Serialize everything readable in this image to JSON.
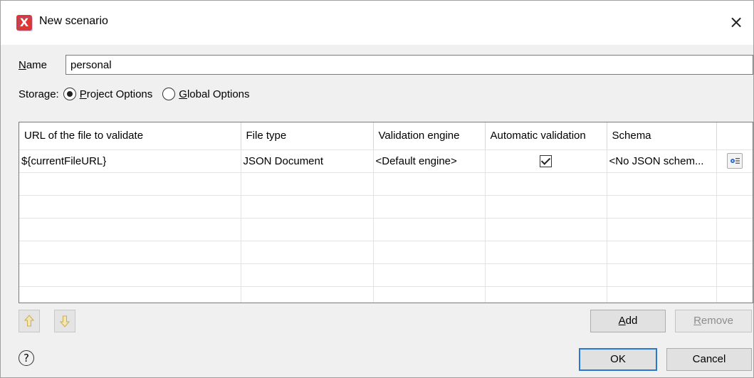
{
  "window": {
    "title": "New scenario",
    "close_glyph": "×"
  },
  "name_field": {
    "label_mnemonic": "N",
    "label_rest": "ame",
    "value": "personal"
  },
  "storage": {
    "label": "Storage:",
    "options": [
      {
        "mnemonic": "P",
        "rest": "roject Options",
        "checked": true
      },
      {
        "mnemonic": "G",
        "rest": "lobal Options",
        "checked": false
      }
    ]
  },
  "table": {
    "columns": [
      "URL of the file to validate",
      "File type",
      "Validation engine",
      "Automatic validation",
      "Schema",
      ""
    ],
    "rows": [
      {
        "url": "${currentFileURL}",
        "file_type": "JSON Document",
        "engine": "<Default engine>",
        "automatic": true,
        "schema": "<No JSON schem..."
      }
    ],
    "empty_rows": 6
  },
  "buttons": {
    "move_up_icon": "arrow-up-icon",
    "move_down_icon": "arrow-down-icon",
    "add_mnemonic": "A",
    "add_rest": "dd",
    "remove_mnemonic": "R",
    "remove_rest": "emove",
    "ok": "OK",
    "cancel": "Cancel",
    "help_glyph": "?"
  },
  "colors": {
    "dialog_bg": "#f0f0f0",
    "default_button_border": "#2a76d2",
    "app_icon": "#e4342f",
    "arrow_disabled": "#d8c070"
  }
}
